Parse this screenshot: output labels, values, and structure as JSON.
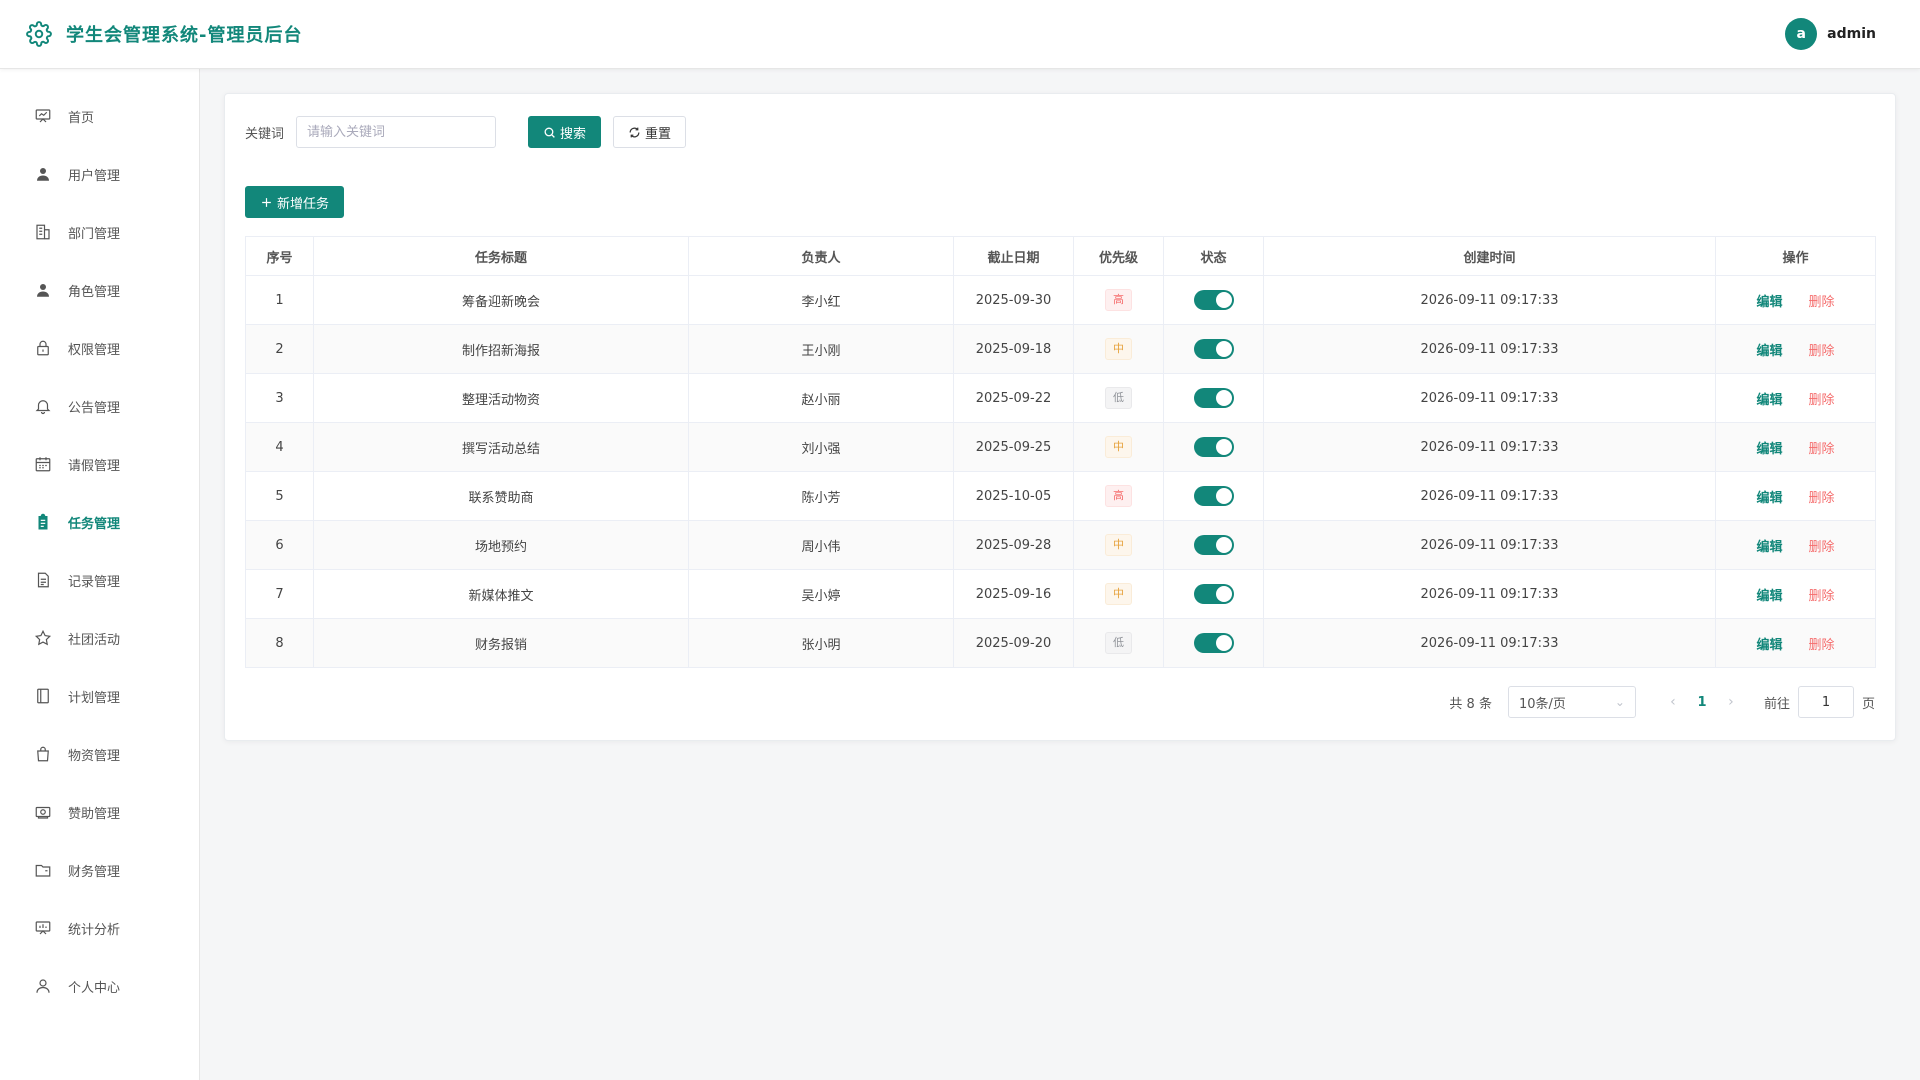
{
  "app": {
    "title": "学生会管理系统-管理员后台",
    "accent": "#12877a"
  },
  "user": {
    "avatar_letter": "a",
    "name": "admin"
  },
  "sidebar": {
    "items": [
      {
        "label": "首页",
        "icon": "dashboard-icon",
        "active": false
      },
      {
        "label": "用户管理",
        "icon": "user-icon",
        "active": false
      },
      {
        "label": "部门管理",
        "icon": "building-icon",
        "active": false
      },
      {
        "label": "角色管理",
        "icon": "role-icon",
        "active": false
      },
      {
        "label": "权限管理",
        "icon": "lock-icon",
        "active": false
      },
      {
        "label": "公告管理",
        "icon": "bell-icon",
        "active": false
      },
      {
        "label": "请假管理",
        "icon": "calendar-icon",
        "active": false
      },
      {
        "label": "任务管理",
        "icon": "task-icon",
        "active": true
      },
      {
        "label": "记录管理",
        "icon": "document-icon",
        "active": false
      },
      {
        "label": "社团活动",
        "icon": "star-icon",
        "active": false
      },
      {
        "label": "计划管理",
        "icon": "notebook-icon",
        "active": false
      },
      {
        "label": "物资管理",
        "icon": "bag-icon",
        "active": false
      },
      {
        "label": "赞助管理",
        "icon": "money-icon",
        "active": false
      },
      {
        "label": "财务管理",
        "icon": "wallet-icon",
        "active": false
      },
      {
        "label": "统计分析",
        "icon": "chart-icon",
        "active": false
      },
      {
        "label": "个人中心",
        "icon": "profile-icon",
        "active": false
      }
    ]
  },
  "search": {
    "label": "关键词",
    "placeholder": "请输入关键词",
    "search_label": "搜索",
    "reset_label": "重置"
  },
  "actions": {
    "add_label": "新增任务"
  },
  "table": {
    "columns": [
      "序号",
      "任务标题",
      "负责人",
      "截止日期",
      "优先级",
      "状态",
      "创建时间",
      "操作"
    ],
    "rows": [
      {
        "index": "1",
        "title": "筹备迎新晚会",
        "owner": "李小红",
        "deadline": "2025-09-30",
        "priority": "高",
        "level": "high",
        "enabled": true,
        "created": "2026-09-11 09:17:33"
      },
      {
        "index": "2",
        "title": "制作招新海报",
        "owner": "王小刚",
        "deadline": "2025-09-18",
        "priority": "中",
        "level": "mid",
        "enabled": true,
        "created": "2026-09-11 09:17:33"
      },
      {
        "index": "3",
        "title": "整理活动物资",
        "owner": "赵小丽",
        "deadline": "2025-09-22",
        "priority": "低",
        "level": "low",
        "enabled": true,
        "created": "2026-09-11 09:17:33"
      },
      {
        "index": "4",
        "title": "撰写活动总结",
        "owner": "刘小强",
        "deadline": "2025-09-25",
        "priority": "中",
        "level": "mid",
        "enabled": true,
        "created": "2026-09-11 09:17:33"
      },
      {
        "index": "5",
        "title": "联系赞助商",
        "owner": "陈小芳",
        "deadline": "2025-10-05",
        "priority": "高",
        "level": "high",
        "enabled": true,
        "created": "2026-09-11 09:17:33"
      },
      {
        "index": "6",
        "title": "场地预约",
        "owner": "周小伟",
        "deadline": "2025-09-28",
        "priority": "中",
        "level": "mid",
        "enabled": true,
        "created": "2026-09-11 09:17:33"
      },
      {
        "index": "7",
        "title": "新媒体推文",
        "owner": "吴小婷",
        "deadline": "2025-09-16",
        "priority": "中",
        "level": "mid",
        "enabled": true,
        "created": "2026-09-11 09:17:33"
      },
      {
        "index": "8",
        "title": "财务报销",
        "owner": "张小明",
        "deadline": "2025-09-20",
        "priority": "低",
        "level": "low",
        "enabled": true,
        "created": "2026-09-11 09:17:33"
      }
    ],
    "edit_label": "编辑",
    "delete_label": "删除"
  },
  "pagination": {
    "total_text": "共 8 条",
    "page_size": "10条/页",
    "current_page": "1",
    "goto_label": "前往",
    "goto_value": "1",
    "page_suffix": "页"
  }
}
